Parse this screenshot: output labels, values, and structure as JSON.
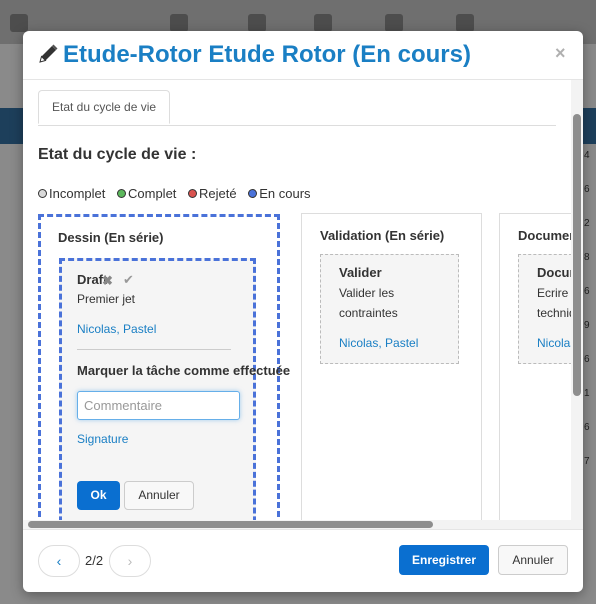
{
  "modal": {
    "title": "Etude-Rotor Etude Rotor (En cours)",
    "close_symbol": "×",
    "tab_label": "Etat du cycle de vie",
    "section_title": "Etat du cycle de vie :"
  },
  "legend": [
    {
      "label": "Incomplet",
      "color": "#d9d9d9"
    },
    {
      "label": "Complet",
      "color": "#5cb85c"
    },
    {
      "label": "Rejeté",
      "color": "#d9534f"
    },
    {
      "label": "En cours",
      "color": "#4a72d9"
    }
  ],
  "lanes": [
    {
      "title": "Dessin (En série)",
      "task": {
        "name": "Draft",
        "description": "Premier jet",
        "user": "Nicolas, Pastel",
        "mark_label": "Marquer la tâche comme effectuée",
        "comment_placeholder": "Commentaire",
        "signature_label": "Signature",
        "ok_label": "Ok",
        "cancel_label": "Annuler"
      }
    },
    {
      "title": "Validation (En série)",
      "task": {
        "name": "Valider",
        "description": "Valider les contraintes",
        "user": "Nicolas, Pastel"
      }
    },
    {
      "title": "Documentation",
      "task": {
        "name": "Documentation",
        "description": "Ecrire la technique",
        "user": "Nicolas"
      }
    }
  ],
  "footer": {
    "prev_symbol": "‹",
    "next_symbol": "›",
    "page_label": "2/2",
    "save_label": "Enregistrer",
    "cancel_label": "Annuler"
  },
  "background": {
    "row_numbers": [
      "4",
      "6",
      "2",
      "8",
      "6",
      "9",
      "6",
      "1",
      "6",
      "7"
    ]
  }
}
